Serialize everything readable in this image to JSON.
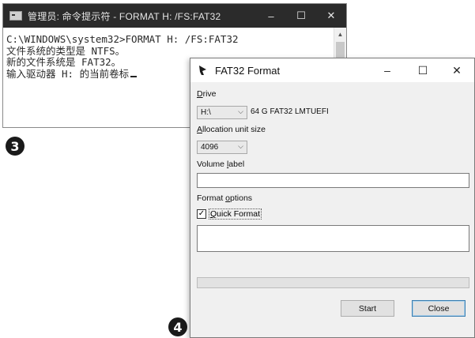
{
  "console": {
    "title": "管理员: 命令提示符 - FORMAT  H: /FS:FAT32",
    "min_glyph": "–",
    "max_glyph": "☐",
    "close_glyph": "✕",
    "scroll_up_glyph": "▲",
    "lines": [
      "C:\\WINDOWS\\system32>FORMAT H: /FS:FAT32",
      "文件系统的类型是 NTFS。",
      "新的文件系统是 FAT32。",
      "输入驱动器 H: 的当前卷标"
    ]
  },
  "badges": {
    "step3": "3",
    "step4": "4"
  },
  "dialog": {
    "title": "FAT32 Format",
    "min_glyph": "–",
    "max_glyph": "☐",
    "close_glyph": "✕",
    "drive": {
      "label_key": "D",
      "label_rest": "rive",
      "value": "H:\\",
      "info": "64 G FAT32 LMTUEFI"
    },
    "allocation": {
      "label_key": "A",
      "label_rest": "llocation unit size",
      "value": "4096"
    },
    "volume": {
      "label_pre": "Volume ",
      "label_key": "l",
      "label_rest": "abel",
      "value": ""
    },
    "options": {
      "label_pre": "Format ",
      "label_key": "o",
      "label_rest": "ptions"
    },
    "quick_format": {
      "label_key": "Q",
      "label_rest": "uick Format",
      "checked_glyph": "✓"
    },
    "start_label": "Start",
    "close_label": "Close",
    "dropdown_glyph": "⌵"
  }
}
